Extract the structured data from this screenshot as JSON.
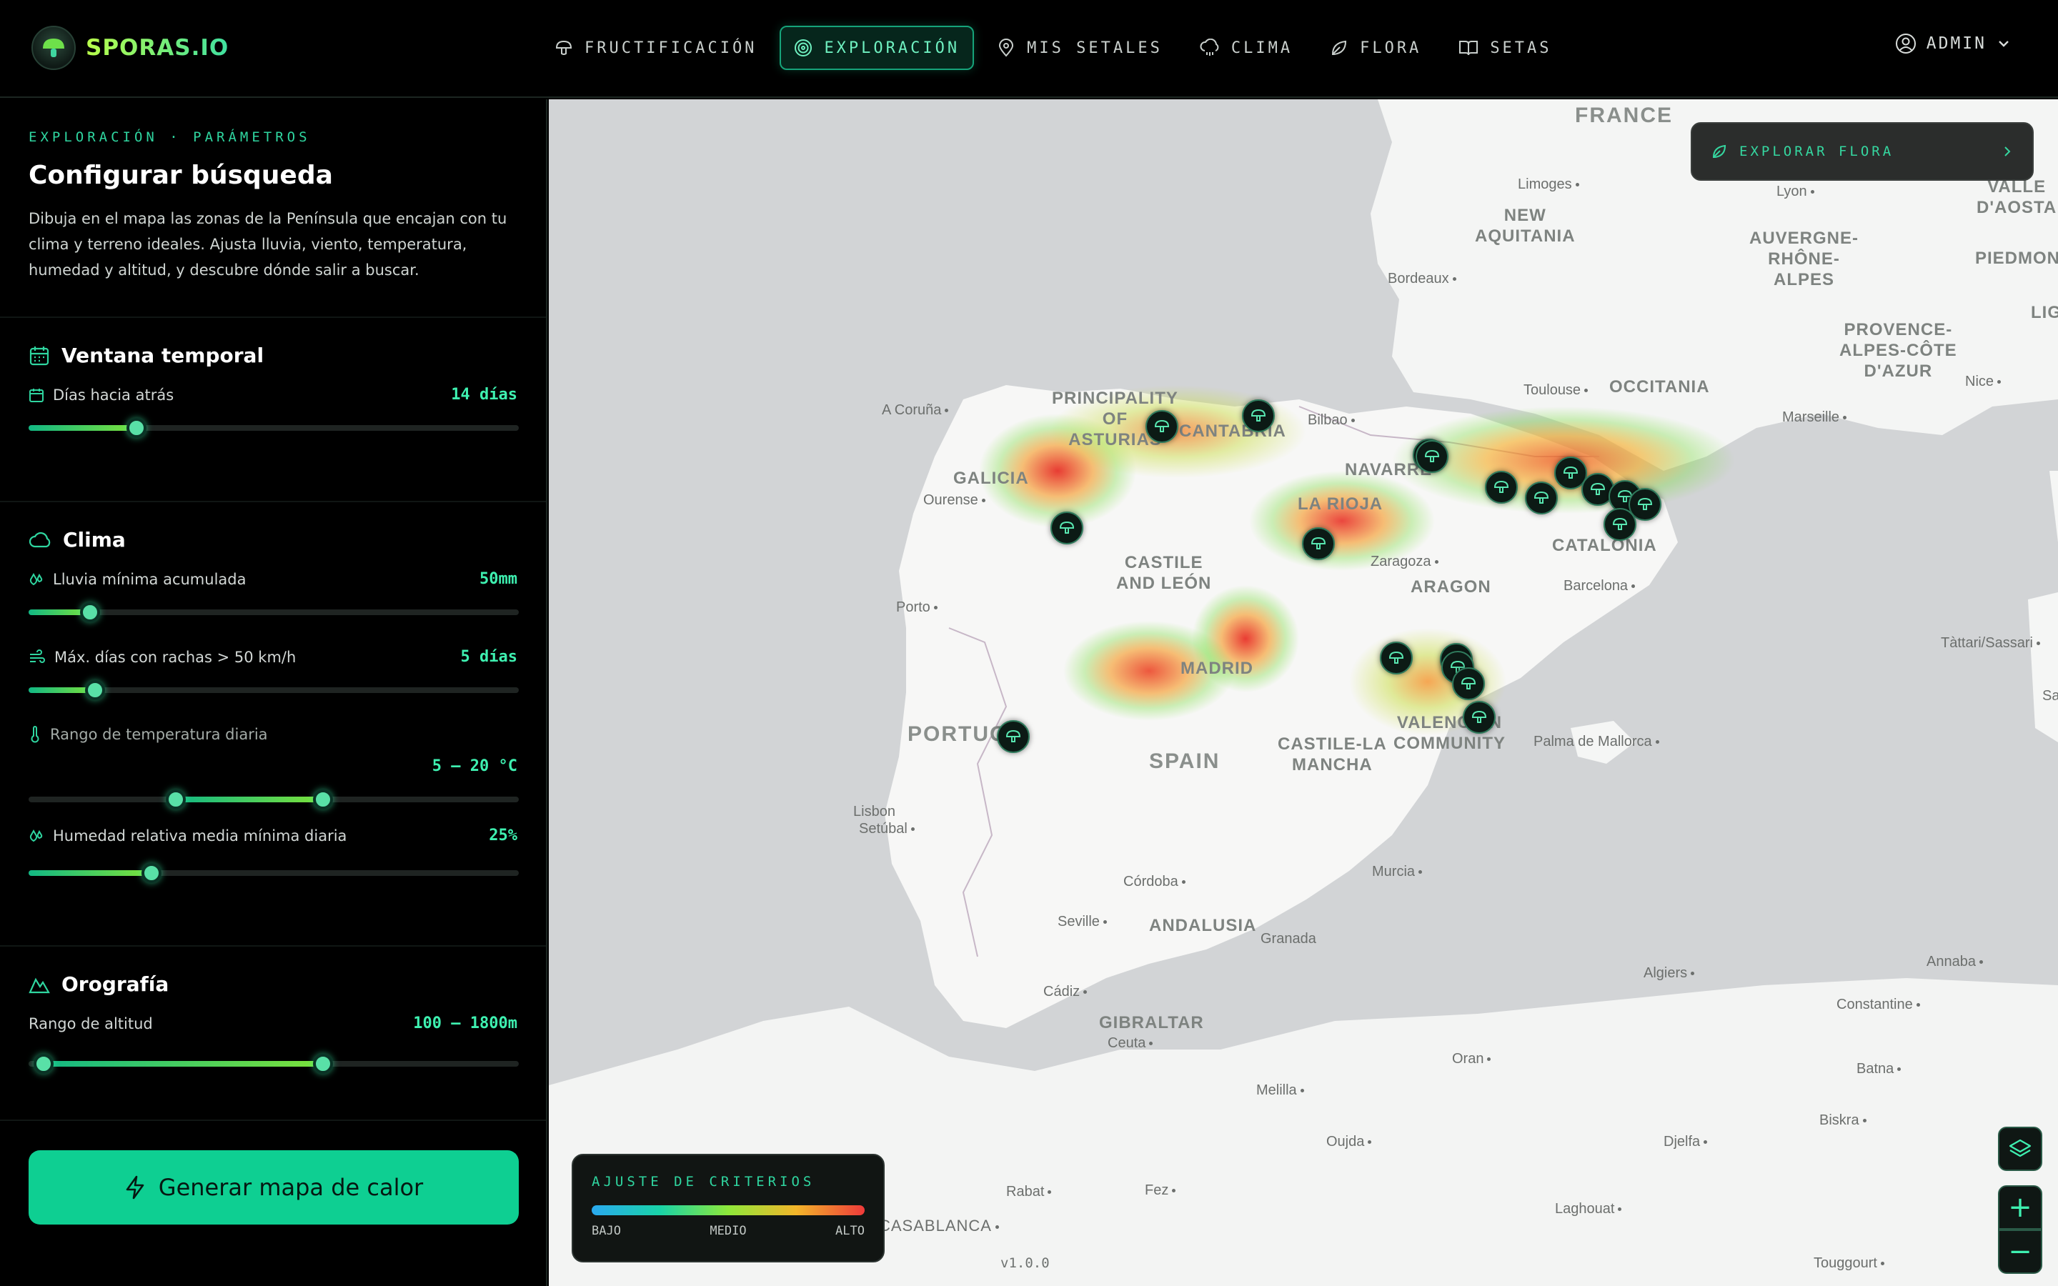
{
  "app": {
    "brand": "SPORAS.IO",
    "user_label": "ADMIN"
  },
  "nav": [
    {
      "label": "FRUCTIFICACIÓN",
      "icon": "mushroom-icon",
      "active": false
    },
    {
      "label": "EXPLORACIÓN",
      "icon": "target-icon",
      "active": true
    },
    {
      "label": "MIS SETALES",
      "icon": "map-pin-icon",
      "active": false
    },
    {
      "label": "CLIMA",
      "icon": "cloud-rain-icon",
      "active": false
    },
    {
      "label": "FLORA",
      "icon": "leaf-icon",
      "active": false
    },
    {
      "label": "SETAS",
      "icon": "book-icon",
      "active": false
    }
  ],
  "sidebar": {
    "eyebrow": "EXPLORACIÓN · PARÁMETROS",
    "title": "Configurar búsqueda",
    "description": "Dibuja en el mapa las zonas de la Península que encajan con tu clima y terreno ideales. Ajusta lluvia, viento, temperatura, humedad y altitud, y descubre dónde salir a buscar.",
    "ventana": {
      "title": "Ventana temporal",
      "dias_label": "Días hacia atrás",
      "dias_value": "14 días",
      "dias_fraction": 0.22
    },
    "clima": {
      "title": "Clima",
      "lluvia_label": "Lluvia mínima acumulada",
      "lluvia_value": "50mm",
      "lluvia_fraction": 0.125,
      "viento_label": "Máx. días con rachas > 50 km/h",
      "viento_value": "5 días",
      "viento_fraction": 0.135,
      "temp_label": "Rango de temperatura diaria",
      "temp_value": "5 – 20 °C",
      "temp_low_fraction": 0.3,
      "temp_high_fraction": 0.6,
      "humedad_label": "Humedad relativa media mínima diaria",
      "humedad_value": "25%",
      "humedad_fraction": 0.25
    },
    "orografia": {
      "title": "Orografía",
      "altitud_label": "Rango de altitud",
      "altitud_value": "100 – 1800m",
      "altitud_low_fraction": 0.03,
      "altitud_high_fraction": 0.6
    },
    "generate_label": "Generar mapa de calor"
  },
  "map": {
    "explore_flora_label": "EXPLORAR FLORA",
    "legend": {
      "title": "AJUSTE DE CRITERIOS",
      "low": "BAJO",
      "mid": "MEDIO",
      "high": "ALTO"
    },
    "version": "v1.0.0",
    "zoom_in": "+",
    "zoom_out": "−",
    "labels": {
      "france": "FRANCE",
      "spain": "SPAIN",
      "portugal": "PORTUG",
      "new_aquitania": "NEW\nAQUITANIA",
      "occitania": "OCCITANIA",
      "auvergne": "AUVERGNE-\nRHÔNE-\nALPES",
      "provence": "PROVENCE-\nALPES-CÔTE\nD'AZUR",
      "valle": "VALLE\nD'AOSTA",
      "piedmont": "PIEDMONT",
      "lig": "LIG",
      "principality": "PRINCIPALITY\nOF\nASTURIAS",
      "cantabria": "CANTABRIA",
      "galicia": "GALICIA",
      "navarre": "NAVARRE",
      "la_rioja": "LA RIOJA",
      "castile_leon": "CASTILE\nAND LEÓN",
      "aragon": "ARAGON",
      "catalonia": "CATALONIA",
      "madrid": "MADRID",
      "castile_mancha": "CASTILE-LA\nMANCHA",
      "valencian": "VALENCIAN\nCOMMUNITY",
      "andalusia": "ANDALUSIA",
      "gibraltar": "GIBRALTAR",
      "limoges": "Limoges",
      "lyon": "Lyon",
      "bordeaux": "Bordeaux",
      "toulouse": "Toulouse",
      "marseille": "Marseille",
      "nice": "Nice",
      "a_coruna": "A Coruña",
      "bilbao": "Bilbao",
      "ourense": "Ourense",
      "zaragoza": "Zaragoza",
      "barcelona": "Barcelona",
      "porto": "Porto",
      "tattari": "Tàttari/Sassari",
      "sa": "Sa",
      "palma": "Palma de Mallorca",
      "lisbon": "Lisbon",
      "setubal": "Setúbal",
      "cordoba": "Córdoba",
      "murcia": "Murcia",
      "seville": "Seville",
      "granada": "Granada",
      "cadiz": "Cádiz",
      "ceuta": "Ceuta",
      "algiers": "Algiers",
      "annaba": "Annaba",
      "constantine": "Constantine",
      "oran": "Oran",
      "melilla": "Melilla",
      "batna": "Batna",
      "biskra": "Biskra",
      "oujda": "Oujda",
      "djelfa": "Djelfa",
      "rabat": "Rabat",
      "fez": "Fez",
      "laghouat": "Laghouat",
      "casablanca": "CASABLANCA",
      "touggourt": "Touggourt"
    }
  }
}
